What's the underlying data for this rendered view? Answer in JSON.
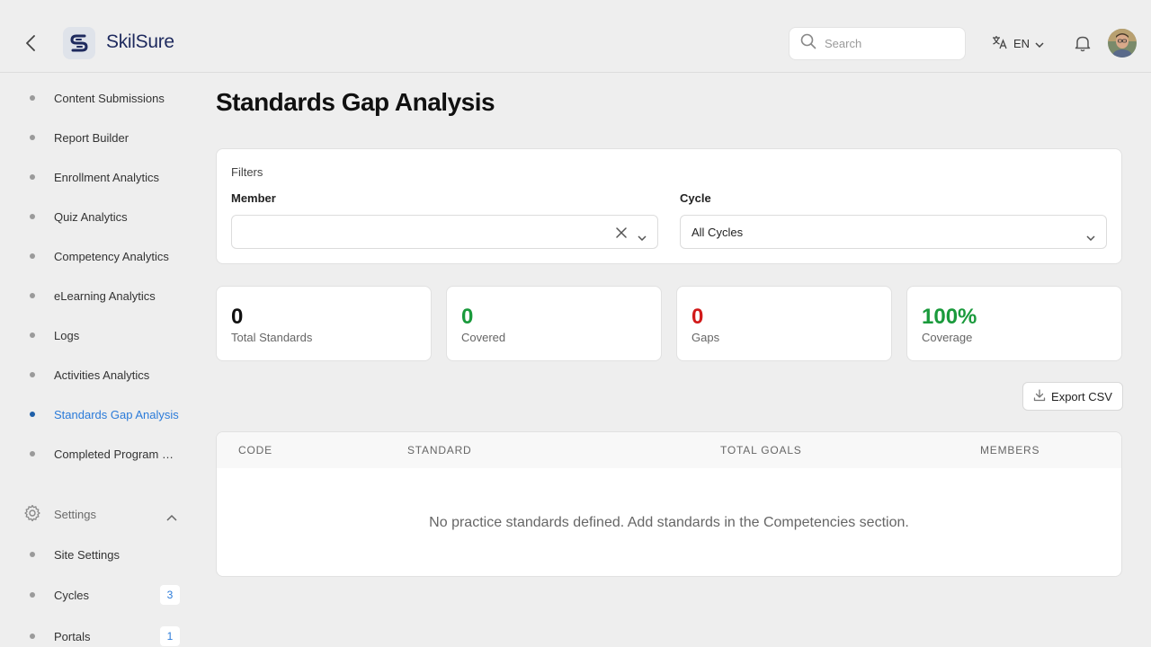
{
  "header": {
    "app_name": "SkilSure",
    "search_placeholder": "Search",
    "language": "EN"
  },
  "sidebar": {
    "items": [
      {
        "label": "Content Submissions"
      },
      {
        "label": "Report Builder"
      },
      {
        "label": "Enrollment Analytics"
      },
      {
        "label": "Quiz Analytics"
      },
      {
        "label": "Competency Analytics"
      },
      {
        "label": "eLearning Analytics"
      },
      {
        "label": "Logs"
      },
      {
        "label": "Activities Analytics"
      },
      {
        "label": "Standards Gap Analysis"
      },
      {
        "label": "Completed Program Reports"
      }
    ],
    "settings": {
      "label": "Settings",
      "items": [
        {
          "label": "Site Settings"
        },
        {
          "label": "Cycles",
          "badge": "3"
        },
        {
          "label": "Portals",
          "badge": "1"
        }
      ]
    }
  },
  "main": {
    "title": "Standards Gap Analysis",
    "filters": {
      "title": "Filters",
      "member_label": "Member",
      "member_value": "",
      "cycle_label": "Cycle",
      "cycle_value": "All Cycles"
    },
    "stats": [
      {
        "value": "0",
        "label": "Total Standards",
        "color": "#111111"
      },
      {
        "value": "0",
        "label": "Covered",
        "color": "#1a9a3c"
      },
      {
        "value": "0",
        "label": "Gaps",
        "color": "#d11a1a"
      },
      {
        "value": "100%",
        "label": "Coverage",
        "color": "#1a9a3c"
      }
    ],
    "export_label": "Export CSV",
    "table": {
      "columns": [
        "CODE",
        "STANDARD",
        "TOTAL GOALS",
        "MEMBERS"
      ],
      "empty_message": "No practice standards defined. Add standards in the Competencies section."
    }
  },
  "colors": {
    "accent": "#2b7bd9",
    "brand_navy": "#1e2a5e"
  }
}
